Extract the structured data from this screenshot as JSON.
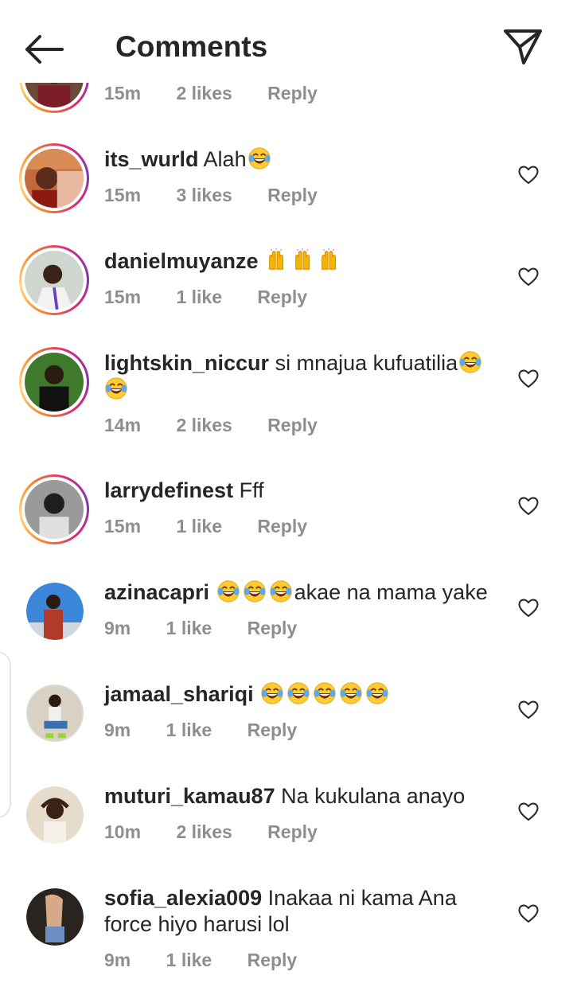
{
  "header": {
    "title": "Comments",
    "back_icon": "arrow-left-icon",
    "share_icon": "paper-plane-icon"
  },
  "partial_comment": {
    "time": "15m",
    "likes": "2 likes",
    "reply": "Reply"
  },
  "comments": [
    {
      "username": "its_wurld",
      "text": "Alah",
      "emoji_after": 1,
      "time": "15m",
      "likes": "3 likes",
      "reply": "Reply"
    },
    {
      "username": "danielmuyanze",
      "text": "",
      "time": "15m",
      "likes": "1 like",
      "reply": "Reply"
    },
    {
      "username": "lightskin_niccur",
      "text": "si mnajua kufuatilia",
      "time": "14m",
      "likes": "2 likes",
      "reply": "Reply"
    },
    {
      "username": "larrydefinest",
      "text": "Fff",
      "time": "15m",
      "likes": "1 like",
      "reply": "Reply"
    },
    {
      "username": "azinacapri",
      "text": "akae na mama yake",
      "time": "9m",
      "likes": "1 like",
      "reply": "Reply"
    },
    {
      "username": "jamaal_shariqi",
      "text": "",
      "time": "9m",
      "likes": "1 like",
      "reply": "Reply"
    },
    {
      "username": "muturi_kamau87",
      "text": "Na kukulana anayo",
      "time": "10m",
      "likes": "2 likes",
      "reply": "Reply"
    },
    {
      "username": "sofia_alexia009",
      "text_line1": "Inakaa ni kama Ana",
      "text_line2": "force hiyo harusi lol",
      "time": "9m",
      "likes": "1 like",
      "reply": "Reply"
    }
  ],
  "colors": {
    "text": "#262626",
    "meta": "#8e8e8e",
    "story_ring": "#dd2a7b"
  },
  "icons": {
    "heart": "heart-outline-icon",
    "laugh": "face-with-tears-of-joy-emoji",
    "raised_hands": "raising-hands-emoji"
  }
}
